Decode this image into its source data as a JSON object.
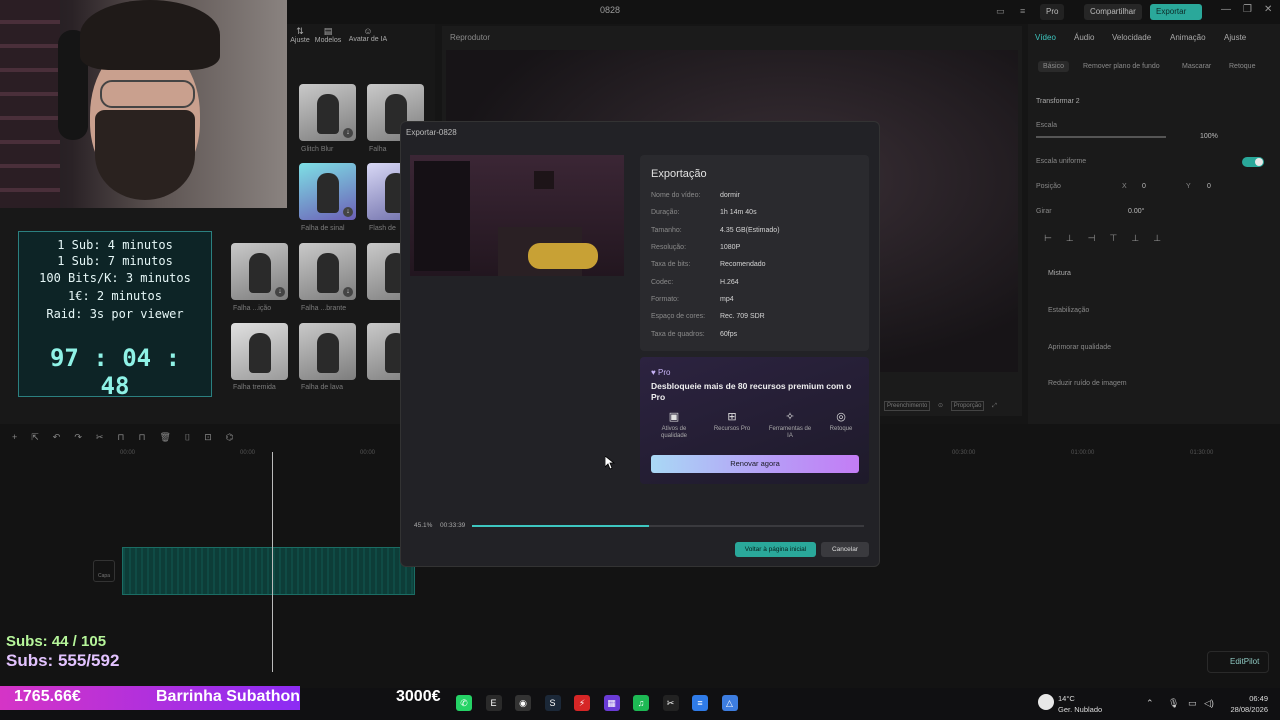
{
  "app": {
    "title": "0828",
    "pro_label": "Pro",
    "share_label": "Compartilhar",
    "export_label": "Exportar"
  },
  "media_tabs": [
    {
      "label": "Ajuste"
    },
    {
      "label": "Modelos"
    },
    {
      "label": "Avatar de IA"
    }
  ],
  "media_thumbs": [
    {
      "caption": "Glitch Blur"
    },
    {
      "caption": "Falha"
    },
    {
      "caption": "Falha de sinal"
    },
    {
      "caption": "Flash de"
    },
    {
      "caption": "Falha ...ição"
    },
    {
      "caption": "Falha ...brante"
    },
    {
      "caption": "Falha tremida"
    },
    {
      "caption": "Falha de lava"
    }
  ],
  "player": {
    "title": "Reprodutor",
    "fill_label": "Preenchimento",
    "ratio_label": "Proporção"
  },
  "right_panel": {
    "tabs": [
      "Vídeo",
      "Áudio",
      "Velocidade",
      "Animação",
      "Ajuste"
    ],
    "subtabs": [
      "Básico",
      "Remover plano de fundo",
      "Mascarar",
      "Retoque"
    ],
    "transform_label": "Transformar 2",
    "scale_label": "Escala",
    "scale_value": "100%",
    "uniform_scale_label": "Escala uniforme",
    "position_label": "Posição",
    "pos_x_label": "X",
    "pos_x": "0",
    "pos_y_label": "Y",
    "pos_y": "0",
    "rotate_label": "Girar",
    "rotate_value": "0.00°",
    "blend_label": "Mistura",
    "stabilize_label": "Estabilização",
    "enhance_label": "Aprimorar qualidade",
    "denoise_label": "Reduzir ruído de imagem"
  },
  "timeline": {
    "ruler": [
      "00:00",
      "00:00",
      "00:00",
      "00:30:00",
      "01:00:00",
      "01:30:00"
    ],
    "cover_label": "Capa",
    "editpilot_label": "EditPilot"
  },
  "export_dialog": {
    "title": "Exportar-0828",
    "section_title": "Exportação",
    "fields": [
      {
        "key": "Nome do vídeo:",
        "value": "dormir"
      },
      {
        "key": "Duração:",
        "value": "1h 14m 40s"
      },
      {
        "key": "Tamanho:",
        "value": "4.35 GB(Estimado)"
      },
      {
        "key": "Resolução:",
        "value": "1080P"
      },
      {
        "key": "Taxa de bits:",
        "value": "Recomendado"
      },
      {
        "key": "Codec:",
        "value": "H.264"
      },
      {
        "key": "Formato:",
        "value": "mp4"
      },
      {
        "key": "Espaço de cores:",
        "value": "Rec. 709 SDR"
      },
      {
        "key": "Taxa de quadros:",
        "value": "60fps"
      }
    ],
    "pro_label": "Pro",
    "pro_headline": "Desbloqueie mais de 80 recursos premium com o Pro",
    "features": [
      {
        "icon": "image-quality-icon",
        "glyph": "▣",
        "label": "Ativos de qualidade"
      },
      {
        "icon": "grid-icon",
        "glyph": "⊞",
        "label": "Recursos Pro"
      },
      {
        "icon": "magic-wand-icon",
        "glyph": "✧",
        "label": "Ferramentas de IA"
      },
      {
        "icon": "retouch-icon",
        "glyph": "◎",
        "label": "Retoque"
      }
    ],
    "renew_label": "Renovar agora",
    "progress_percent_label": "45.1%",
    "progress_fraction": 0.451,
    "progress_time": "00:33:39",
    "back_label": "Voltar à página inicial",
    "cancel_label": "Cancelar"
  },
  "overlay": {
    "goals": [
      "1 Sub: 4 minutos",
      "1 Sub: 7 minutos",
      "100 Bits/K: 3 minutos",
      "1€: 2 minutos",
      "Raid: 3s por viewer"
    ],
    "countdown": "97 : 04 : 48",
    "subs_line1": "Subs: 44 / 105",
    "subs_line2": "Subs: 555/592",
    "bar_amount": "1765.66€",
    "bar_title": "Barrinha Subathon",
    "bar_goal": "3000€"
  },
  "taskbar": {
    "icons": [
      {
        "name": "whatsapp-icon",
        "glyph": "✆",
        "color": "#25d366"
      },
      {
        "name": "epic-games-icon",
        "glyph": "E",
        "color": "#2a2a2a"
      },
      {
        "name": "obs-icon",
        "glyph": "◉",
        "color": "#333333"
      },
      {
        "name": "steam-icon",
        "glyph": "S",
        "color": "#1b2838"
      },
      {
        "name": "power-app-icon",
        "glyph": "⚡",
        "color": "#d62626"
      },
      {
        "name": "grid-app-icon",
        "glyph": "▦",
        "color": "#6a3bd6"
      },
      {
        "name": "spotify-icon",
        "glyph": "♫",
        "color": "#1db954"
      },
      {
        "name": "capcut-icon",
        "glyph": "✂",
        "color": "#222222"
      },
      {
        "name": "notes-icon",
        "glyph": "≡",
        "color": "#2f7be8"
      },
      {
        "name": "drive-icon",
        "glyph": "△",
        "color": "#3d7de0"
      }
    ],
    "weather_temp": "14°C",
    "weather_desc": "Ger. Nublado",
    "time": "06:49",
    "date": "28/08/2026"
  }
}
